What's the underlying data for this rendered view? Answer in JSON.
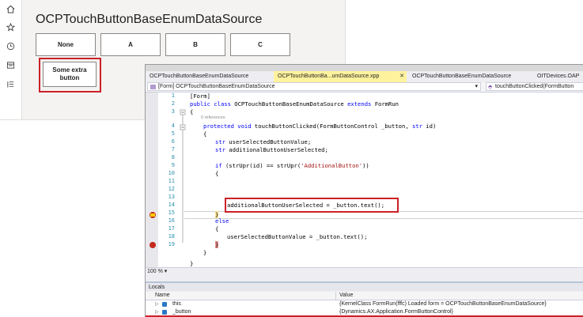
{
  "form": {
    "title": "OCPTouchButtonBaseEnumDataSource",
    "buttons": [
      "None",
      "A",
      "B",
      "C"
    ],
    "extra_button": "Some extra button",
    "nav_icons": [
      "home-icon",
      "star-icon",
      "clock-icon",
      "workspace-icon",
      "list-icon"
    ]
  },
  "vs": {
    "tabs": [
      {
        "label": "OCPTouchButtonBaseEnumDataSource",
        "active": false,
        "closable": false
      },
      {
        "label": "OCPTouchButtonBa...umDataSource.xpp",
        "active": true,
        "closable": true
      },
      {
        "label": "OCPTouchButtonBaseEnumDataSource",
        "active": false,
        "closable": false
      },
      {
        "label": "OITDevices.OAP",
        "active": false,
        "closable": false
      }
    ],
    "member_dropdown": "[Form] OCPTouchButtonBaseEnumDataSource",
    "method_dropdown": "touchButtonClicked(FormButton",
    "zoom": "100 %",
    "references": "0 references",
    "line_numbers": [
      "1",
      "2",
      "3",
      "4",
      "5",
      "6",
      "7",
      "8",
      "9",
      "10",
      "11",
      "12",
      "13",
      "14",
      "15",
      "16",
      "17",
      "18",
      "19"
    ],
    "code": {
      "l1": "[Form]",
      "l2_kw": "public class",
      "l2_rest": " OCPTouchButtonBaseEnumDataSource ",
      "l2_kw2": "extends",
      "l2_rest2": " FormRun",
      "l3": "{",
      "l4_kw": "protected void",
      "l4_rest": " touchButtonClicked(FormButtonControl _button, ",
      "l4_kw2": "str",
      "l4_rest2": " id)",
      "l5": "{",
      "l6_kw": "str",
      "l6_rest": " userSelectedButtonValue;",
      "l7_kw": "str",
      "l7_rest": " additionalButtonUserSelected;",
      "l9_kw": "if",
      "l9_rest": " (strUpr(id) == strUpr(",
      "l9_str": "'AdditionalButton'",
      "l9_end": "))",
      "l10": "{",
      "l11": "additionalButtonUserSelected = _button.text();",
      "l12": "}",
      "l13_kw": "else",
      "l14": "{",
      "l15": "userSelectedButtonValue = _button.text();",
      "l16": "}",
      "l17": "}",
      "l19": "}"
    },
    "locals": {
      "title": "Locals",
      "col_name": "Name",
      "col_value": "Value",
      "rows": [
        {
          "name": "this",
          "value": "{KernelClass FormRun(fffc) Loaded form = OCPTouchButtonBaseEnumDataSource}"
        },
        {
          "name": "_button",
          "value": "{Dynamics.AX.Application.FormButtonControl}"
        }
      ]
    }
  },
  "colors": {
    "highlight_red": "#cc2027",
    "active_tab": "#fff29d",
    "keyword": "#0000ff",
    "string": "#a31515",
    "line_number": "#2b91af"
  }
}
